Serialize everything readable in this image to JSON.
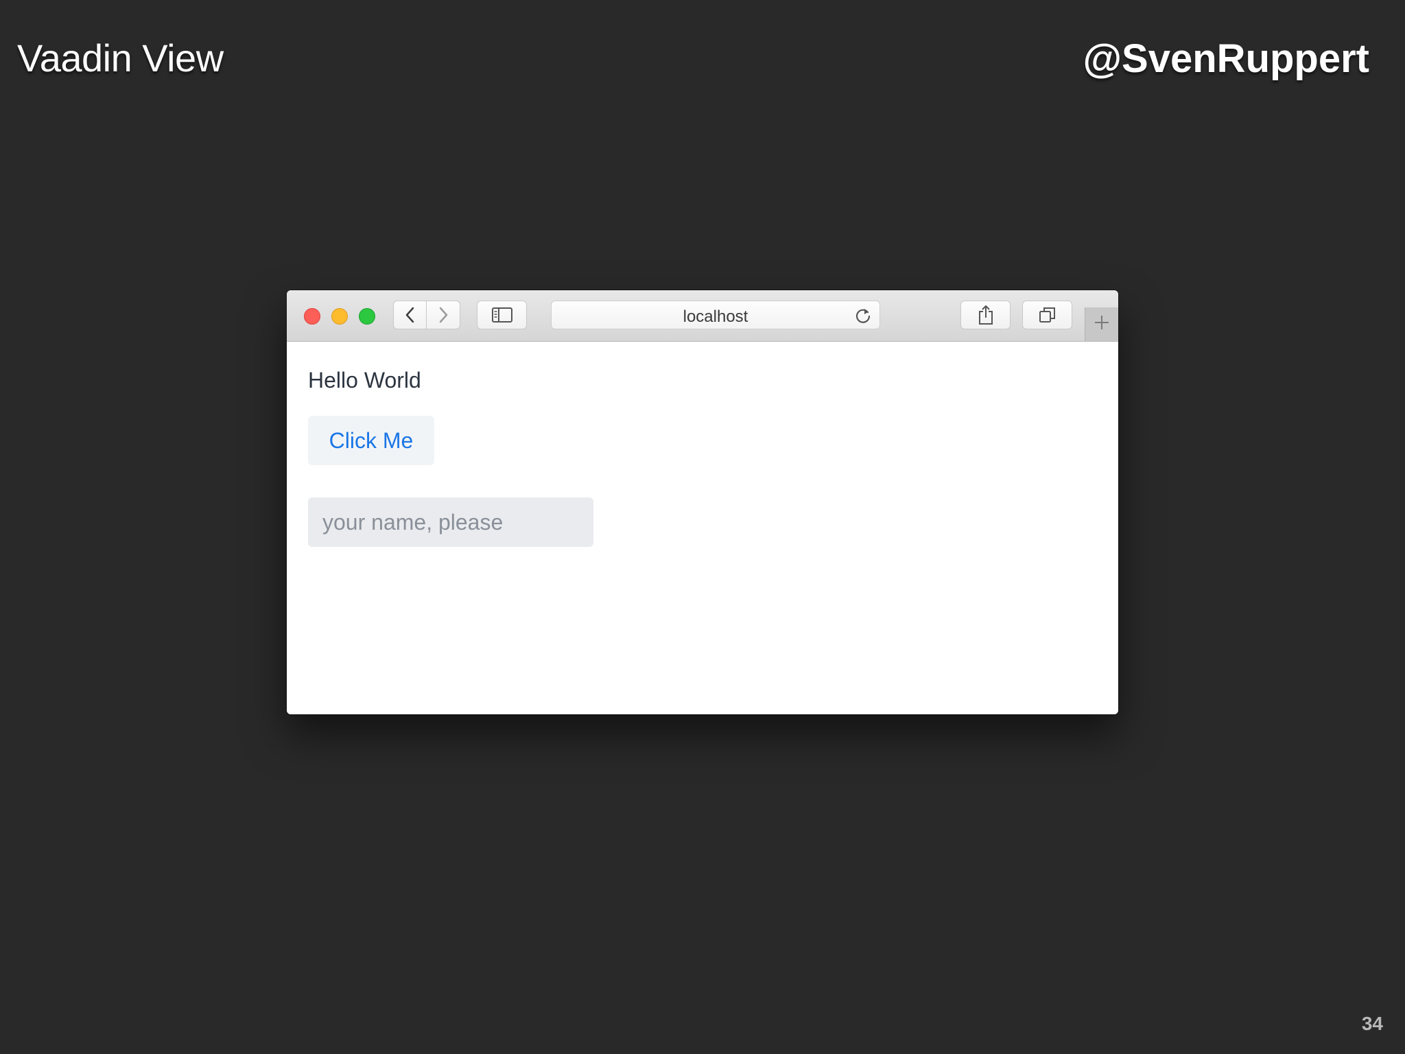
{
  "slide": {
    "title": "Vaadin View",
    "handle": "@SvenRuppert",
    "page_number": "34"
  },
  "browser": {
    "address": "localhost",
    "icons": {
      "back": "chevron-left-icon",
      "forward": "chevron-right-icon",
      "sidebar": "sidebar-icon",
      "reload": "reload-icon",
      "share": "share-icon",
      "tabs": "tabs-overview-icon",
      "new_tab": "plus-icon"
    },
    "traffic_colors": {
      "close": "#fc5f57",
      "minimize": "#fdbb2e",
      "zoom": "#2bc840"
    }
  },
  "page": {
    "greeting": "Hello World",
    "button_label": "Click Me",
    "name_placeholder": "your name, please",
    "name_value": ""
  },
  "colors": {
    "slide_background": "#2a292a",
    "button_text": "#1a76e6",
    "button_background": "#f1f4f7",
    "field_background": "#e9ebee"
  }
}
